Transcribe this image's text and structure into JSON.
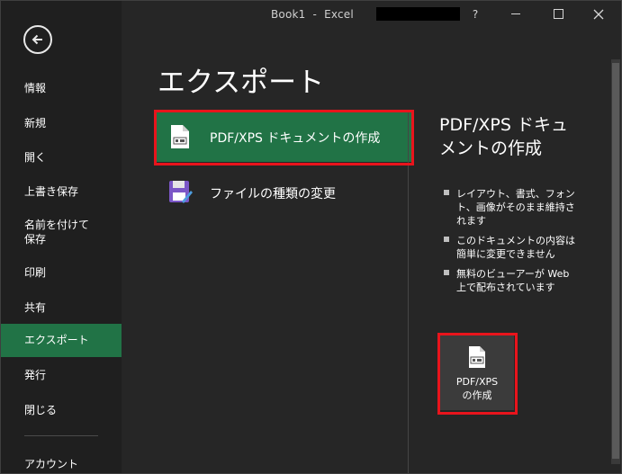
{
  "window": {
    "title": "Book1  -  Excel",
    "help_label": "?"
  },
  "sidebar": {
    "items": [
      {
        "label": "情報"
      },
      {
        "label": "新規"
      },
      {
        "label": "開く"
      },
      {
        "label": "上書き保存"
      },
      {
        "label": "名前を付けて\n保存"
      },
      {
        "label": "印刷"
      },
      {
        "label": "共有"
      },
      {
        "label": "エクスポート",
        "active": true
      },
      {
        "label": "発行"
      },
      {
        "label": "閉じる"
      },
      {
        "label": "アカウント"
      }
    ]
  },
  "main": {
    "title": "エクスポート",
    "options": [
      {
        "label": "PDF/XPS ドキュメントの作成",
        "icon": "pdf-document-icon",
        "selected": true
      },
      {
        "label": "ファイルの種類の変更",
        "icon": "change-file-type-icon"
      }
    ]
  },
  "detail": {
    "title": "PDF/XPS ドキュメントの作成",
    "bullets": [
      "レイアウト、書式、フォント、画像がそのまま維持されます",
      "このドキュメントの内容は簡単に変更できません",
      "無料のビューアーが Web 上で配布されています"
    ],
    "button_label": "PDF/XPS\nの作成"
  },
  "colors": {
    "accent": "#217346",
    "highlight": "#e8141c",
    "background": "#262626",
    "sidebar": "#1f1f1f"
  }
}
